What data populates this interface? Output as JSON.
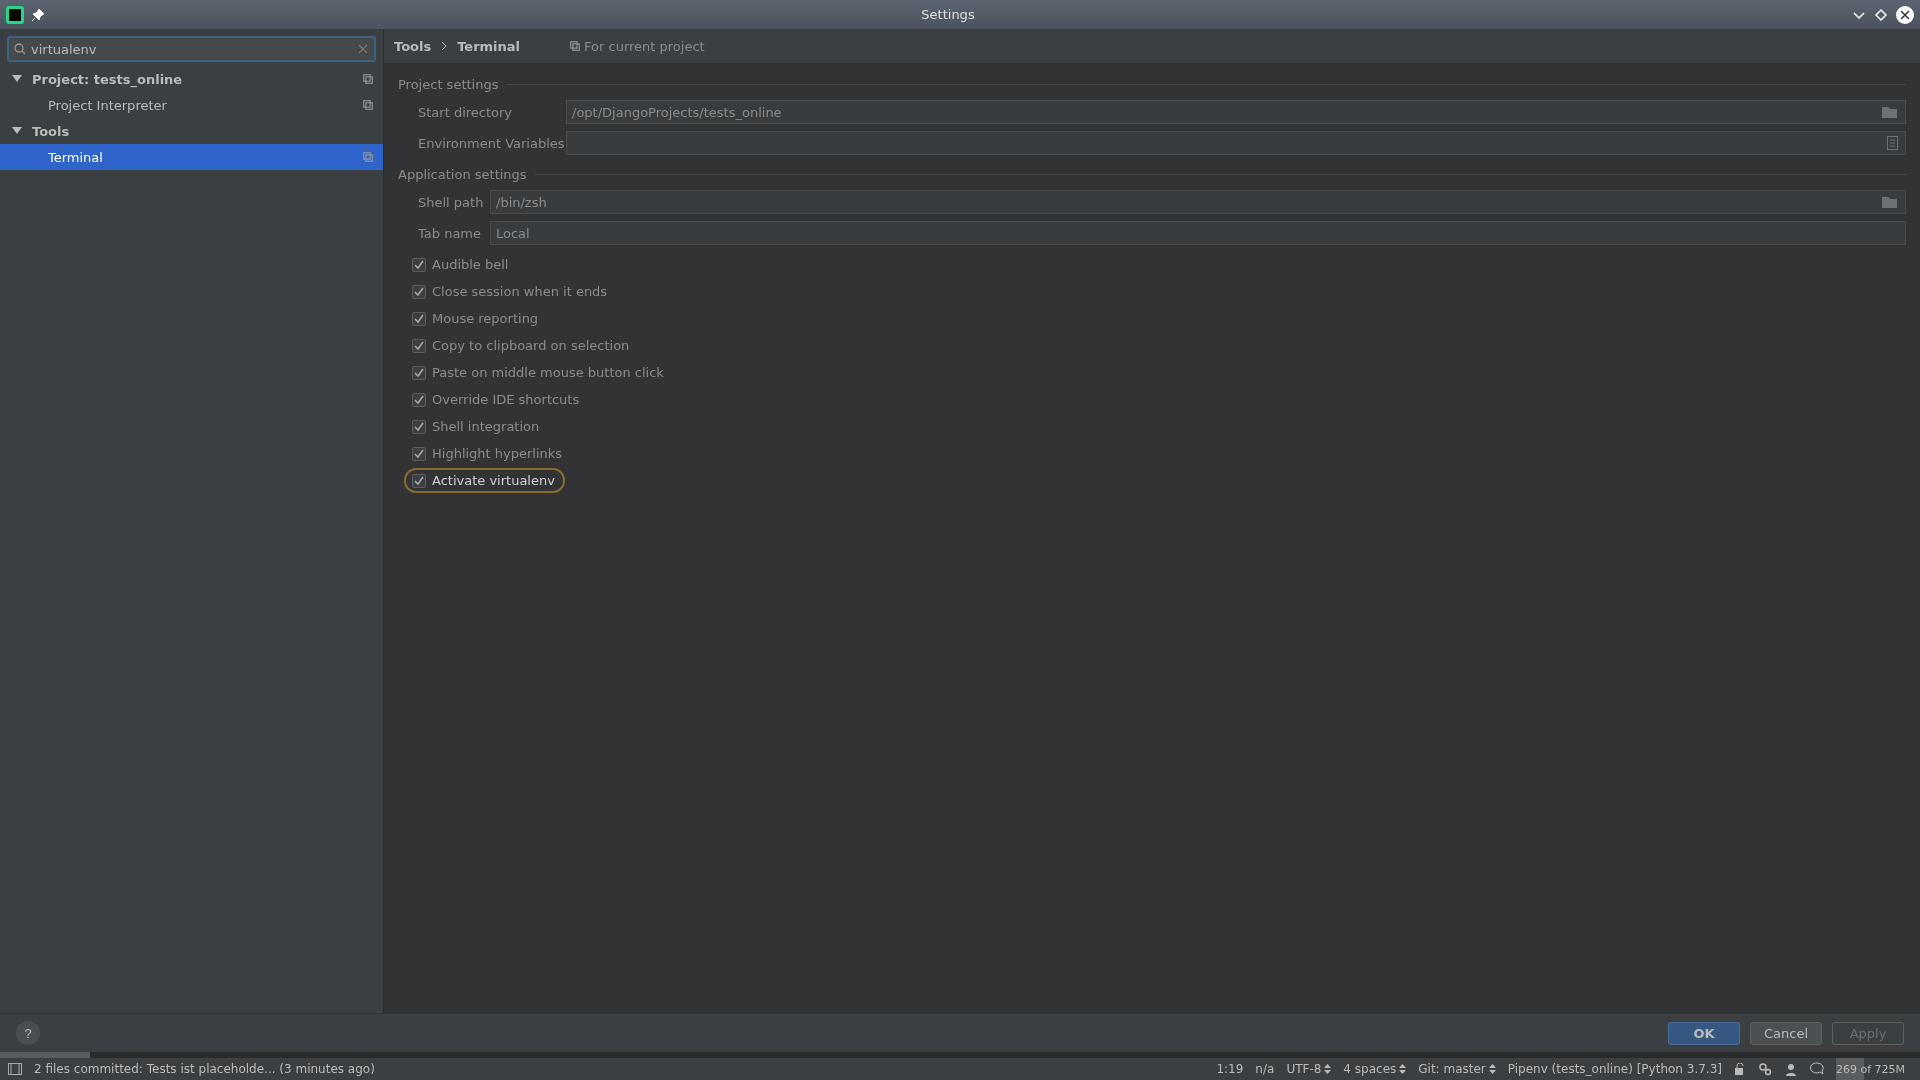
{
  "window": {
    "title": "Settings"
  },
  "search": {
    "value": "virtualenv"
  },
  "tree": [
    {
      "label": "Project: tests_online",
      "expanded": true,
      "selected": false,
      "bold": true,
      "children": [
        {
          "label": "Project Interpreter",
          "selected": false,
          "bold": false
        }
      ]
    },
    {
      "label": "Tools",
      "expanded": true,
      "selected": false,
      "bold": true,
      "children": [
        {
          "label": "Terminal",
          "selected": true,
          "bold": false
        }
      ]
    }
  ],
  "breadcrumb": [
    "Tools",
    "Terminal"
  ],
  "scope": "For current project",
  "sections": [
    {
      "title": "Project settings",
      "fields": [
        {
          "label": "Start directory",
          "value": "/opt/DjangoProjects/tests_online",
          "kind": "folder"
        },
        {
          "label": "Environment Variables",
          "kind": "document"
        }
      ]
    },
    {
      "title": "Application settings",
      "fields": [
        {
          "label": "Shell path",
          "value": "/bin/zsh",
          "kind": "folder"
        },
        {
          "label": "Tab name",
          "value": "Local",
          "kind": "plain"
        }
      ]
    }
  ],
  "options": [
    {
      "label": "Audible bell",
      "checked": true,
      "highlighted": false
    },
    {
      "label": "Close session when it ends",
      "checked": true,
      "highlighted": false
    },
    {
      "label": "Mouse reporting",
      "checked": true,
      "highlighted": false
    },
    {
      "label": "Copy to clipboard on selection",
      "checked": true,
      "highlighted": false
    },
    {
      "label": "Paste on middle mouse button click",
      "checked": true,
      "highlighted": false
    },
    {
      "label": "Override IDE shortcuts",
      "checked": true,
      "highlighted": false
    },
    {
      "label": "Shell integration",
      "checked": true,
      "highlighted": false
    },
    {
      "label": "Highlight hyperlinks",
      "checked": true,
      "highlighted": false
    },
    {
      "label": "Activate virtualenv",
      "checked": true,
      "highlighted": true
    }
  ],
  "help": "?",
  "buttons": [
    {
      "label": "OK",
      "kind": "primary",
      "disabled": false
    },
    {
      "label": "Cancel",
      "kind": "normal",
      "disabled": false
    },
    {
      "label": "Apply",
      "kind": "normal",
      "disabled": true
    }
  ],
  "status_bar": {
    "message": "2 files committed: Tests ist placeholde... (3 minutes ago)",
    "items": [
      {
        "text": "1:19",
        "dropdown": false
      },
      {
        "text": "n/a",
        "dropdown": false
      },
      {
        "text": "UTF-8",
        "dropdown": true
      },
      {
        "text": "4 spaces",
        "dropdown": true
      },
      {
        "text": "Git: master",
        "dropdown": true
      },
      {
        "text": "Pipenv (tests_online) [Python 3.7.3]",
        "dropdown": false
      }
    ],
    "memory": {
      "text": "269 of 725M",
      "level": 0.37
    }
  }
}
